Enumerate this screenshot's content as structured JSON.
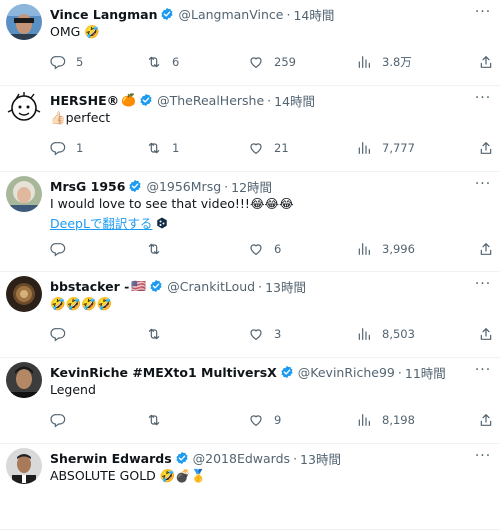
{
  "tweets": [
    {
      "name": "Vince Langman",
      "extra": "",
      "handle": "@LangmanVince",
      "time": "14時間",
      "text": "OMG 🤣",
      "translate": "",
      "replies": "5",
      "retweets": "6",
      "likes": "259",
      "views": "3.8万"
    },
    {
      "name": "HERSHE®",
      "extra": "🍊",
      "handle": "@TheRealHershe",
      "time": "14時間",
      "text": "👍🏻perfect",
      "translate": "",
      "replies": "1",
      "retweets": "1",
      "likes": "21",
      "views": "7,777"
    },
    {
      "name": "MrsG 1956",
      "extra": "",
      "handle": "@1956Mrsg",
      "time": "12時間",
      "text": "I would love to see that video!!!😂😂😂",
      "translate": "DeepLで翻訳する",
      "replies": "",
      "retweets": "",
      "likes": "6",
      "views": "3,996"
    },
    {
      "name": "bbstacker -",
      "extra": "🇺🇸",
      "handle": "@CrankitLoud",
      "time": "13時間",
      "text": "🤣🤣🤣🤣",
      "translate": "",
      "replies": "",
      "retweets": "",
      "likes": "3",
      "views": "8,503"
    },
    {
      "name": "KevinRiche #MEXto1 MultiversX",
      "extra": "",
      "handle": "@KevinRiche99",
      "time": "11時間",
      "text": "Legend",
      "translate": "",
      "replies": "",
      "retweets": "",
      "likes": "9",
      "views": "8,198"
    },
    {
      "name": "Sherwin Edwards",
      "extra": "",
      "handle": "@2018Edwards",
      "time": "13時間",
      "text": "ABSOLUTE GOLD 🤣💣🥇",
      "translate": "",
      "replies": "",
      "retweets": "",
      "likes": "",
      "views": ""
    }
  ],
  "separator": "·",
  "colors": {
    "verified": "#1d9bf0",
    "secondary_text": "#536471",
    "link": "#1d9bf0",
    "divider": "#eff3f4"
  },
  "icons": {
    "verified": "verified-badge-icon",
    "more": "more-options-icon",
    "reply": "reply-icon",
    "retweet": "retweet-icon",
    "like": "like-heart-icon",
    "views": "views-chart-icon",
    "share": "share-icon",
    "translate": "deepl-icon"
  }
}
